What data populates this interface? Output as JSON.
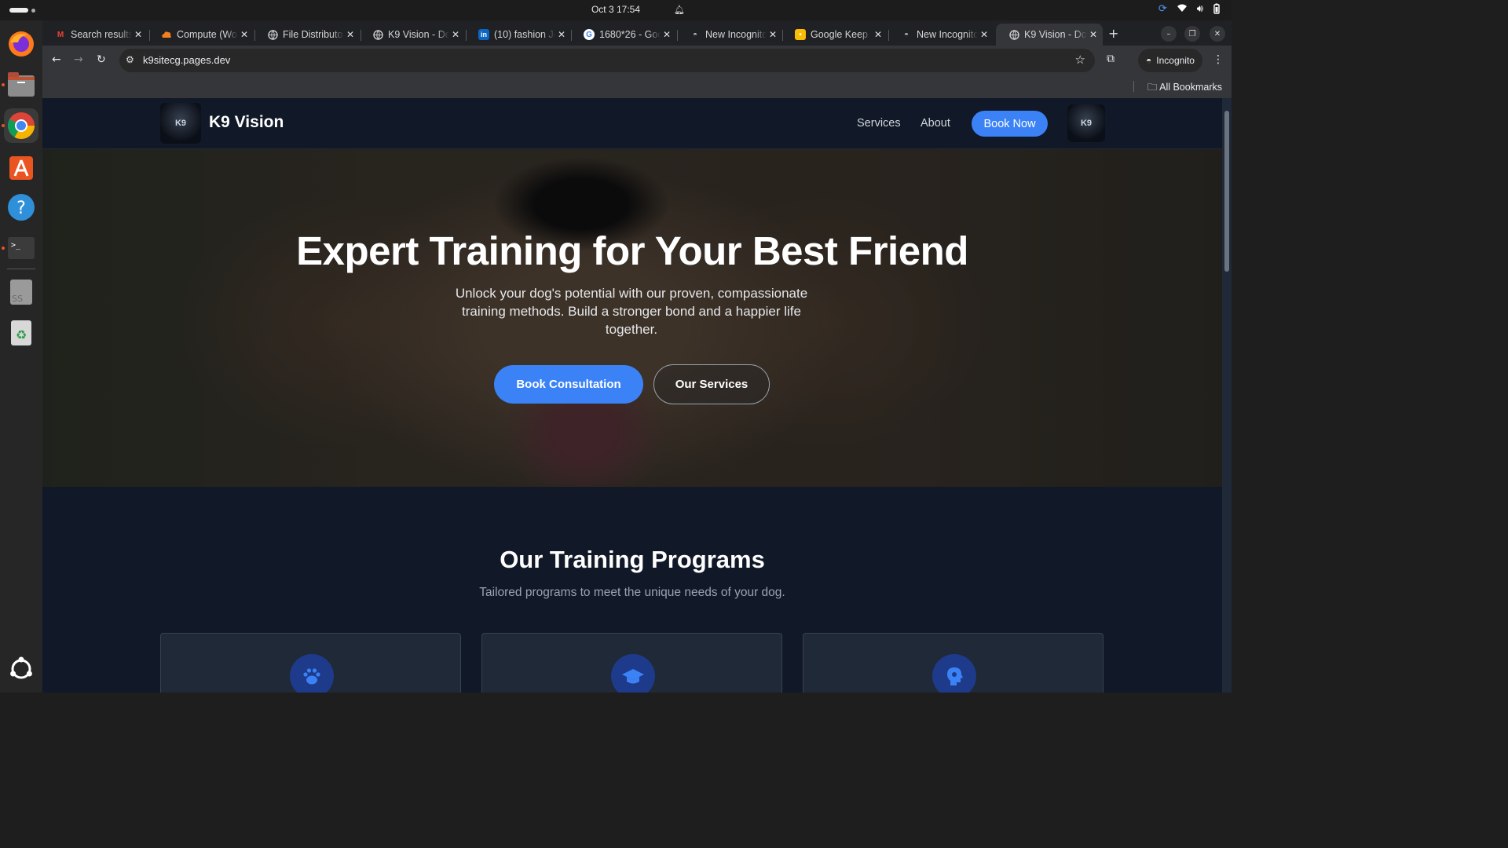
{
  "system": {
    "clock": "Oct 3  17:54"
  },
  "browser": {
    "tabs": [
      {
        "label": "Search results",
        "favicon": "gmail-icon"
      },
      {
        "label": "Compute (Wo",
        "favicon": "cloud-icon"
      },
      {
        "label": "File Distributo",
        "favicon": "globe-icon"
      },
      {
        "label": "K9 Vision - Do",
        "favicon": "globe-icon"
      },
      {
        "label": "(10) fashion Jo",
        "favicon": "linkedin-icon"
      },
      {
        "label": "1680*26 - Goo",
        "favicon": "google-icon"
      },
      {
        "label": "New Incognito",
        "favicon": "incognito-icon"
      },
      {
        "label": "Google Keep",
        "favicon": "keep-icon"
      },
      {
        "label": "New Incognito",
        "favicon": "incognito-icon"
      },
      {
        "label": "K9 Vision - Do",
        "favicon": "globe-icon",
        "active": true
      }
    ],
    "url": "k9sitecg.pages.dev",
    "incognito_label": "Incognito",
    "bookmarks_label": "All Bookmarks"
  },
  "site": {
    "brand": "K9 Vision",
    "logo_text": "K9",
    "nav": {
      "services": "Services",
      "about": "About",
      "book_now": "Book Now"
    },
    "hero": {
      "title": "Expert Training for Your Best Friend",
      "subtitle": "Unlock your dog's potential with our proven, compassionate training methods. Build a stronger bond and a happier life together.",
      "cta_primary": "Book Consultation",
      "cta_secondary": "Our Services"
    },
    "programs": {
      "title": "Our Training Programs",
      "subtitle": "Tailored programs to meet the unique needs of your dog.",
      "cards": [
        {
          "icon": "paw-icon"
        },
        {
          "icon": "graduation-cap-icon"
        },
        {
          "icon": "brain-icon"
        }
      ]
    }
  },
  "colors": {
    "accent": "#3b82f6",
    "page_bg": "#111827",
    "card_bg": "#1f2937"
  }
}
